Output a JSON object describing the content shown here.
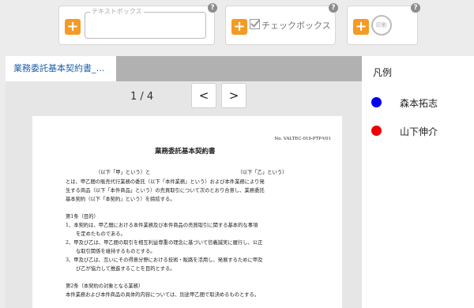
{
  "toolbar": {
    "textbox": {
      "placeholder": "テキストボックス"
    },
    "checkbox": {
      "label": "チェックボックス"
    },
    "seal": {
      "label": "印影"
    },
    "add_label": "+",
    "help_label": "?"
  },
  "tabs": [
    {
      "label": "業務委託基本契約書_…",
      "active": true
    }
  ],
  "viewer": {
    "page_indicator": "1 / 4",
    "prev_label": "<",
    "next_label": ">"
  },
  "document": {
    "doc_number": "No. VALTEC-019-PTP-V01",
    "title": "業務委託基本契約書",
    "parties_line": "（以下「甲」という）と　　　　　　　　　　　　　　　　　　（以下「乙」という）",
    "intro_1": "とは、甲乙間の販売代行業務の委託（以下「本件業務」という）および本件業務により発",
    "intro_2": "生する商品（以下「本件商品」という）の売買取引について次のとおり合意し、業務委託",
    "intro_3": "基本契約（以下「本契約」という）を締結する。",
    "art1_heading": "第1条（目的）",
    "art1_1a": "1、本契約は、甲乙間における本件業務及び本件商品の売買取引に関する基本的な事項",
    "art1_1b": "を定めたものである。",
    "art1_2a": "2、甲及び乙は、甲乙間の取引を相互利益尊重の理念に基づいて信義誠実に履行し、公正",
    "art1_2b": "な取引関係を維持するものとする。",
    "art1_3a": "3、甲及び乙は、互いにその得意分野における技術・販路を活用し、発展するために甲及",
    "art1_3b": "び乙が協力して推進することを目的とする。",
    "art2_heading": "第2条（本契約の対象となる業務）",
    "art2_1": "本件業務および本件商品の具体的内容については、別途甲乙間で取決めるものとする。"
  },
  "legend": {
    "title": "凡例",
    "items": [
      {
        "name": "森本拓志",
        "color": "#0000ee"
      },
      {
        "name": "山下伸介",
        "color": "#ee0000"
      }
    ]
  }
}
